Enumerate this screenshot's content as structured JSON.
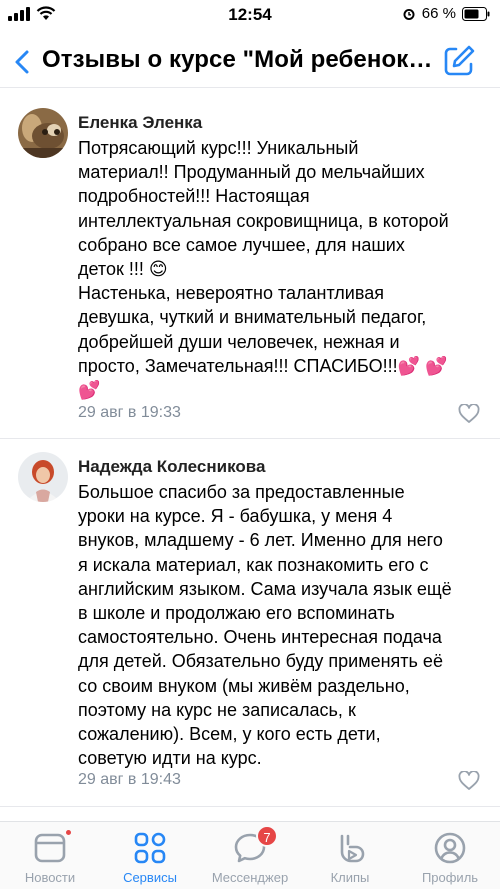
{
  "status_bar": {
    "time": "12:54",
    "battery": "66 %"
  },
  "nav": {
    "title": "Отзывы о курсе \"Мой ребенок учит английский\""
  },
  "reviews": [
    {
      "author": "Еленка Эленка",
      "text": "Потрясающий курс!!! Уникальный\nматериал!! Продуманный до мельчайших\nподробностей!!! Настоящая\nинтеллектуальная сокровищница, в которой\nсобрано все самое лучшее, для наших\nдеток !!! 😊\nНастенька, невероятно талантливая\nдевушка, чуткий и внимательный педагог,\nдобрейшей души человечек, нежная и\nпросто, Замечательная!!! СПАСИБО!!!💕 💕\n💕",
      "date": "29 авг в 19:33"
    },
    {
      "author": "Надежда Колесникова",
      "text": "Большое спасибо за предоставленные\nуроки на курсе. Я - бабушка, у меня 4\nвнуков, младшему - 6 лет. Именно для него\nя искала материал, как познакомить его с\nанглийским языком. Сама изучала язык ещё\nв школе и продолжаю его вспоминать\nсамостоятельно. Очень интересная подача\nдля детей. Обязательно буду применять её\nсо своим внуком (мы живём раздельно,\nпоэтому на курс не записалась, к\nсожалению). Всем, у кого есть дети,\nсоветую идти на курс.",
      "date": "29 авг в 19:43"
    }
  ],
  "tabs": [
    {
      "label": "Новости",
      "icon": "news-icon"
    },
    {
      "label": "Сервисы",
      "icon": "services-icon"
    },
    {
      "label": "Мессенджер",
      "icon": "messenger-icon",
      "badge": "7"
    },
    {
      "label": "Клипы",
      "icon": "clips-icon"
    },
    {
      "label": "Профиль",
      "icon": "profile-icon"
    }
  ],
  "colors": {
    "accent": "#2787f5",
    "muted": "#99a2ad",
    "badge": "#e64646",
    "date": "#818c99"
  }
}
